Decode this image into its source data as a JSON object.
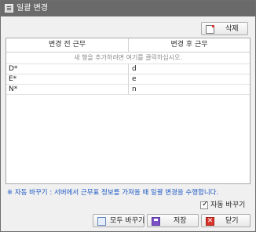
{
  "window": {
    "title": "일괄 변경",
    "icon": "list-icon"
  },
  "toolbar": {
    "delete_label": "삭제",
    "delete_icon": "delete-doc-icon"
  },
  "grid": {
    "columns": [
      "변경 전 근무",
      "변경 후 근무"
    ],
    "new_row_hint": "새 행을 추가하려면 여기를 클릭하십시오.",
    "rows": [
      {
        "before": "D*",
        "after": "d"
      },
      {
        "before": "E*",
        "after": "e"
      },
      {
        "before": "N*",
        "after": "n"
      }
    ]
  },
  "note": "※ 자동 바꾸기 : 서버에서 근무표 정보를 가져올 때 일괄 변경을 수행합니다.",
  "auto_replace": {
    "label": "자동 바꾸기",
    "checked": true
  },
  "buttons": {
    "change_all": "모두 바꾸기",
    "save": "저장",
    "close": "닫기"
  },
  "colors": {
    "titlebar": "#6a6a6a",
    "note": "#1b57c4",
    "close_icon": "#d8342b",
    "save_icon": "#7b52c8"
  }
}
